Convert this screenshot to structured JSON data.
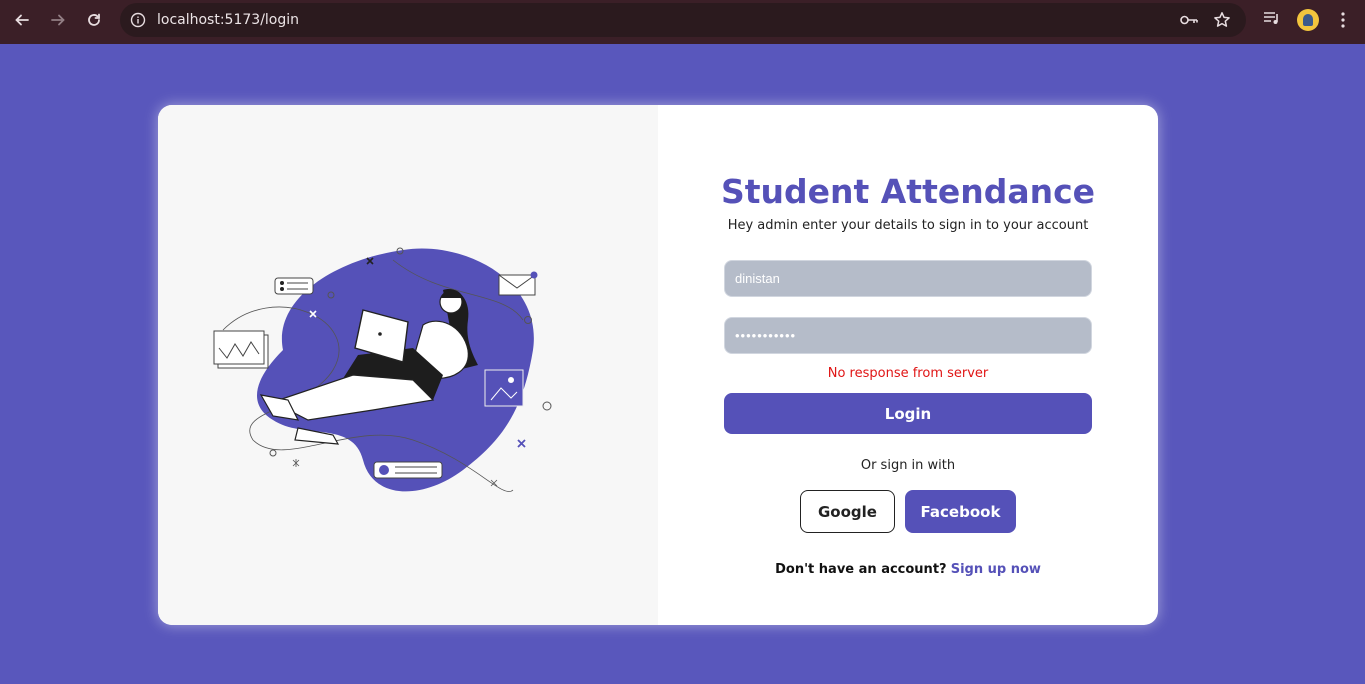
{
  "browser": {
    "url": "localhost:5173/login",
    "colors": {
      "frame": "#3b1f27",
      "omnibox": "#2b1a1e"
    }
  },
  "page": {
    "background": "#5957bc",
    "accent": "#5551b8"
  },
  "login": {
    "title": "Student Attendance",
    "subtitle": "Hey admin enter your details to sign in to your account",
    "username_value": "dinistan",
    "password_value": "•••••••••••",
    "error_message": "No response from server",
    "login_label": "Login",
    "or_text": "Or sign in with",
    "google_label": "Google",
    "facebook_label": "Facebook",
    "signup_question": "Don't have an account?",
    "signup_link": "Sign up now"
  },
  "illustration": {
    "subject": "woman-with-laptop-illustration"
  }
}
